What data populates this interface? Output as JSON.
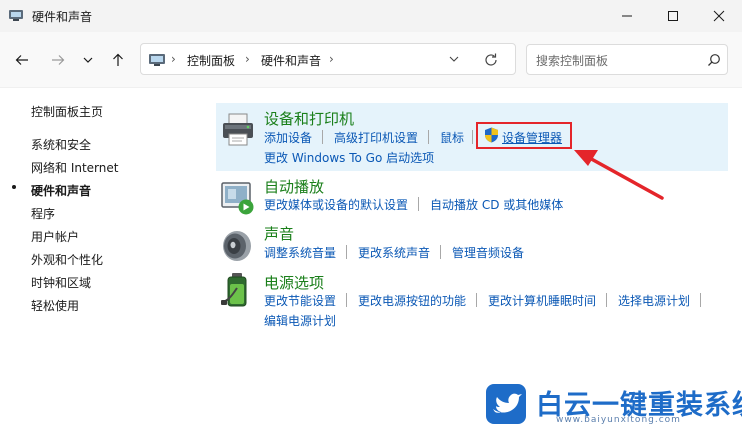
{
  "window": {
    "title": "硬件和声音"
  },
  "address": {
    "crumbs": [
      "控制面板",
      "硬件和声音"
    ]
  },
  "search": {
    "placeholder": "搜索控制面板"
  },
  "sidebar": {
    "items": [
      {
        "label": "控制面板主页"
      },
      {
        "label": "系统和安全"
      },
      {
        "label": "网络和 Internet"
      },
      {
        "label": "硬件和声音",
        "active": true
      },
      {
        "label": "程序"
      },
      {
        "label": "用户帐户"
      },
      {
        "label": "外观和个性化"
      },
      {
        "label": "时钟和区域"
      },
      {
        "label": "轻松使用"
      }
    ]
  },
  "categories": [
    {
      "title": "设备和打印机",
      "icon": "printer-icon",
      "links": [
        "添加设备",
        "高级打印机设置",
        "鼠标",
        "设备管理器",
        "更改 Windows To Go 启动选项"
      ]
    },
    {
      "title": "自动播放",
      "icon": "autoplay-icon",
      "links": [
        "更改媒体或设备的默认设置",
        "自动播放 CD 或其他媒体"
      ]
    },
    {
      "title": "声音",
      "icon": "speaker-icon",
      "links": [
        "调整系统音量",
        "更改系统声音",
        "管理音频设备"
      ]
    },
    {
      "title": "电源选项",
      "icon": "battery-icon",
      "links": [
        "更改节能设置",
        "更改电源按钮的功能",
        "更改计算机睡眠时间",
        "选择电源计划",
        "编辑电源计划"
      ]
    }
  ],
  "watermark": {
    "main": "白云一键重装系统",
    "url": "www.baiyunxitong.com"
  },
  "colors": {
    "link": "#0b58b5",
    "category_title": "#1a7f1a",
    "highlight": "#e5f3fb",
    "annotation_red": "#e4252a",
    "watermark_blue": "#1e6cc8"
  }
}
